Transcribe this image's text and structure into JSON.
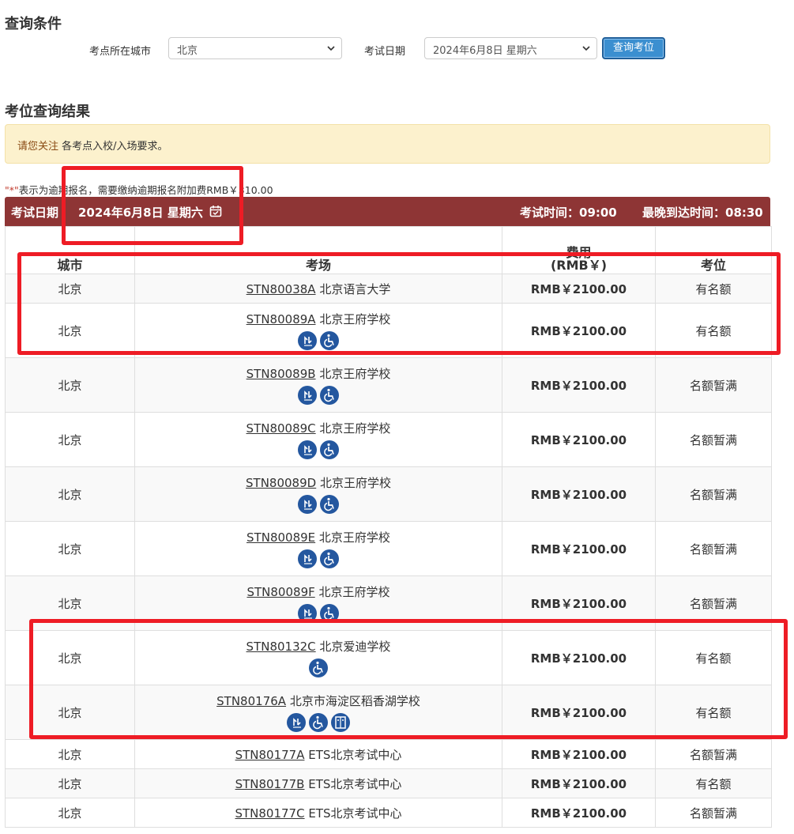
{
  "search": {
    "title": "查询条件",
    "city_label": "考点所在城市",
    "city_value": "北京",
    "date_label": "考试日期",
    "date_value": "2024年6月8日 星期六",
    "button": "查询考位"
  },
  "results": {
    "title": "考位查询结果",
    "notice_highlight": "请您关注",
    "notice_text": " 各考点入校/入场要求。",
    "note_star": "\"*\"",
    "note_text": "表示为逾期报名，需要缴纳逾期报名附加费RMB￥310.00",
    "bar": {
      "date_label": "考试日期",
      "date_value": "2024年6月8日 星期六",
      "exam_time": "考试时间：09:00",
      "latest_arrival": "最晚到达时间：08:30"
    },
    "headers": {
      "city": "城市",
      "venue": "考场",
      "fee_line1": "费用",
      "fee_line2": "(RMB￥)",
      "seat": "考位"
    },
    "rows": [
      {
        "city": "北京",
        "code": "STN80038A",
        "name": " 北京语言大学",
        "fee": "RMB￥2100.00",
        "status": "有名额",
        "icons": []
      },
      {
        "city": "北京",
        "code": "STN80089A",
        "name": " 北京王府学校",
        "fee": "RMB￥2100.00",
        "status": "有名额",
        "icons": [
          "hearing-icon",
          "wheelchair-icon"
        ]
      },
      {
        "city": "北京",
        "code": "STN80089B",
        "name": " 北京王府学校",
        "fee": "RMB￥2100.00",
        "status": "名额暂满",
        "icons": [
          "hearing-icon",
          "wheelchair-icon"
        ]
      },
      {
        "city": "北京",
        "code": "STN80089C",
        "name": " 北京王府学校",
        "fee": "RMB￥2100.00",
        "status": "名额暂满",
        "icons": [
          "hearing-icon",
          "wheelchair-icon"
        ]
      },
      {
        "city": "北京",
        "code": "STN80089D",
        "name": " 北京王府学校",
        "fee": "RMB￥2100.00",
        "status": "名额暂满",
        "icons": [
          "hearing-icon",
          "wheelchair-icon"
        ]
      },
      {
        "city": "北京",
        "code": "STN80089E",
        "name": " 北京王府学校",
        "fee": "RMB￥2100.00",
        "status": "名额暂满",
        "icons": [
          "hearing-icon",
          "wheelchair-icon"
        ]
      },
      {
        "city": "北京",
        "code": "STN80089F",
        "name": " 北京王府学校",
        "fee": "RMB￥2100.00",
        "status": "名额暂满",
        "icons": [
          "hearing-icon",
          "wheelchair-icon"
        ]
      },
      {
        "city": "北京",
        "code": "STN80132C",
        "name": " 北京爱迪学校",
        "fee": "RMB￥2100.00",
        "status": "有名额",
        "icons": [
          "wheelchair-icon"
        ]
      },
      {
        "city": "北京",
        "code": "STN80176A",
        "name": " 北京市海淀区稻香湖学校",
        "fee": "RMB￥2100.00",
        "status": "有名额",
        "icons": [
          "hearing-icon",
          "wheelchair-icon",
          "elevator-icon"
        ]
      },
      {
        "city": "北京",
        "code": "STN80177A",
        "name": " ETS北京考试中心",
        "fee": "RMB￥2100.00",
        "status": "名额暂满",
        "icons": []
      },
      {
        "city": "北京",
        "code": "STN80177B",
        "name": " ETS北京考试中心",
        "fee": "RMB￥2100.00",
        "status": "有名额",
        "icons": []
      },
      {
        "city": "北京",
        "code": "STN80177C",
        "name": " ETS北京考试中心",
        "fee": "RMB￥2100.00",
        "status": "名额暂满",
        "icons": []
      }
    ]
  },
  "colors": {
    "bar": "#8e3535",
    "notice_bg": "#fcf1cd",
    "icon_bg": "#24579f",
    "highlight_box": "#ee1c25",
    "button": "#3b8fd0"
  }
}
